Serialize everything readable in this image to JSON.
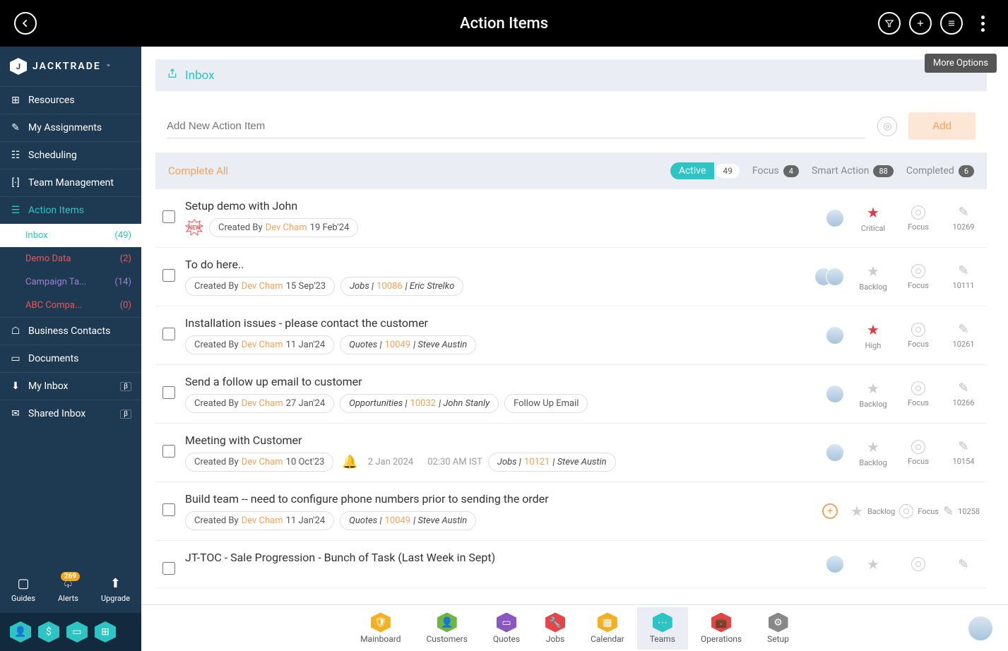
{
  "header": {
    "title": "Action Items",
    "tooltip": "More Options"
  },
  "logo": {
    "text": "JACKTRADE"
  },
  "nav": {
    "resources": "Resources",
    "my_assignments": "My Assignments",
    "scheduling": "Scheduling",
    "team_management": "Team Management",
    "action_items": "Action Items",
    "business_contacts": "Business Contacts",
    "documents": "Documents",
    "my_inbox": "My Inbox",
    "shared_inbox": "Shared Inbox",
    "beta": "β",
    "subs": {
      "inbox": {
        "label": "Inbox",
        "count": "(49)"
      },
      "demo": {
        "label": "Demo Data",
        "count": "(2)"
      },
      "campaign": {
        "label": "Campaign Ta...",
        "count": "(14)"
      },
      "abc": {
        "label": "ABC Compa...",
        "count": "(0)"
      }
    }
  },
  "bottom1": {
    "guides": "Guides",
    "alerts": "Alerts",
    "alerts_count": "269",
    "upgrade": "Upgrade"
  },
  "main": {
    "inbox_title": "Inbox",
    "add_placeholder": "Add New Action Item",
    "add_btn": "Add",
    "complete_all": "Complete All"
  },
  "filters": {
    "active": {
      "label": "Active",
      "count": "49"
    },
    "focus": {
      "label": "Focus",
      "count": "4"
    },
    "smart": {
      "label": "Smart Action",
      "count": "88"
    },
    "completed": {
      "label": "Completed",
      "count": "6"
    }
  },
  "created_by_label": "Created By ",
  "items": [
    {
      "title": "Setup demo with John",
      "is_new": true,
      "creator": "Dev Cham",
      "date": "19 Feb'24",
      "priority": "Critical",
      "star": "red",
      "id": "10269",
      "avatars": 1
    },
    {
      "title": "To do here..",
      "creator": "Dev Cham",
      "date": "15 Sep'23",
      "link_prefix": "Jobs | ",
      "link_num": "10086",
      "link_suffix": " | Eric Strelko",
      "priority": "Backlog",
      "star": "grey",
      "id": "10111",
      "avatars": 2
    },
    {
      "title": "Installation issues - please contact the customer",
      "creator": "Dev Cham",
      "date": "11 Jan'24",
      "link_prefix": "Quotes | ",
      "link_num": "10049",
      "link_suffix": " | Steve Austin",
      "priority": "High",
      "star": "red",
      "id": "10261",
      "avatars": 1
    },
    {
      "title": "Send a follow up email to customer",
      "creator": "Dev Cham",
      "date": "27 Jan'24",
      "link_prefix": "Opportunities | ",
      "link_num": "10032",
      "link_suffix": " | John Stanly",
      "extra_chip": "Follow Up Email",
      "priority": "Backlog",
      "star": "grey",
      "id": "10266",
      "avatars": 1
    },
    {
      "title": "Meeting with Customer",
      "creator": "Dev Cham",
      "date": "10 Oct'23",
      "has_bell": true,
      "due_date": "2 Jan 2024",
      "due_time": "02:30 AM IST",
      "link_prefix": "Jobs | ",
      "link_num": "10121",
      "link_suffix": " | Steve Austin",
      "priority": "Backlog",
      "star": "grey",
      "id": "10154",
      "avatars": 1
    },
    {
      "title": "Build team -- need to configure phone numbers prior to sending the order",
      "creator": "Dev Cham",
      "date": "11 Jan'24",
      "link_prefix": "Quotes | ",
      "link_num": "10049",
      "link_suffix": " | Steve Austin",
      "priority": "Backlog",
      "star": "grey",
      "id": "10258",
      "avatars": 0,
      "add_circle": true,
      "compact_cols": true
    },
    {
      "title": "JT-TOC - Sale Progression - Bunch of Task (Last Week in Sept)",
      "avatars": 1,
      "star": "grey",
      "partial": true
    }
  ],
  "labels": {
    "focus": "Focus"
  },
  "bottomnav": {
    "mainboard": "Mainboard",
    "customers": "Customers",
    "quotes": "Quotes",
    "jobs": "Jobs",
    "calendar": "Calendar",
    "teams": "Teams",
    "operations": "Operations",
    "setup": "Setup"
  },
  "colors": {
    "mainboard": "#f5b021",
    "customers": "#6cb644",
    "quotes": "#8a56c2",
    "jobs": "#e64545",
    "calendar": "#f5b021",
    "teams": "#2ec4c4",
    "operations": "#e64545",
    "setup": "#888"
  }
}
